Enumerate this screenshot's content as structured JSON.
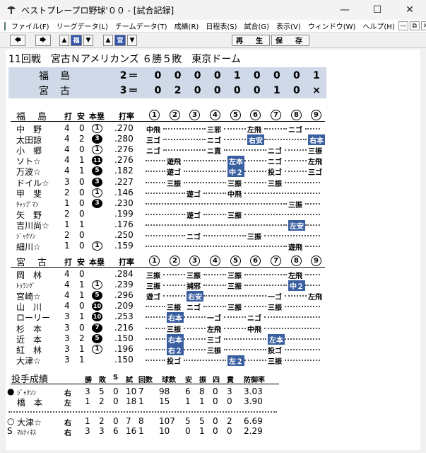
{
  "window": {
    "title": "ベストプレープロ野球'００ - [試合記録]"
  },
  "menu": [
    "ファイル(F)",
    "リーグデータ(L)",
    "チームデータ(T)",
    "成績(R)",
    "日程表(S)",
    "試合(G)",
    "表示(V)",
    "ウィンドウ(W)",
    "ヘルプ(H)"
  ],
  "toolbar": {
    "team1": "福",
    "team2": "宮",
    "replay": "再　生",
    "save": "保　存"
  },
  "game": {
    "header": "11回戦　宮古Ｎアメリカンズ ６勝５敗　東京ドーム"
  },
  "linescore": [
    {
      "team": "福島",
      "runs": "2",
      "eq": "＝",
      "innings": [
        "0",
        "0",
        "0",
        "0",
        "1",
        "0",
        "0",
        "0",
        "1"
      ]
    },
    {
      "team": "宮古",
      "runs": "3",
      "eq": "＝",
      "innings": [
        "0",
        "2",
        "0",
        "0",
        "0",
        "0",
        "1",
        "0",
        "×"
      ]
    }
  ],
  "batting_header": {
    "ab": "打",
    "h": "安",
    "hr": "本塁",
    "avg": "打率",
    "innings": [
      "1",
      "2",
      "3",
      "4",
      "5",
      "6",
      "7",
      "8",
      "9"
    ]
  },
  "fukushima": {
    "team": "福　島",
    "players": [
      {
        "name": "中　野",
        "ab": "4",
        "h": "0",
        "hr": "1",
        "avg": ".270"
      },
      {
        "name": "太田諒",
        "ab": "4",
        "h": "2",
        "hr": "3",
        "avg": ".280"
      },
      {
        "name": "小　郷",
        "ab": "4",
        "h": "0",
        "hr": "1",
        "avg": ".276"
      },
      {
        "name": "ソト☆",
        "ab": "4",
        "h": "1",
        "hr": "11",
        "avg": ".276"
      },
      {
        "name": "万波☆",
        "ab": "4",
        "h": "1",
        "hr": "5",
        "avg": ".182"
      },
      {
        "name": "ドイル☆",
        "ab": "3",
        "h": "0",
        "hr": "3",
        "avg": ".227"
      },
      {
        "name": "甲　斐",
        "ab": "2",
        "h": "0",
        "hr": "1",
        "avg": ".146"
      },
      {
        "name": "ﾁｬｯﾌﾟﾏﾝ",
        "ab": "1",
        "h": "0",
        "hr": "3",
        "avg": ".230"
      },
      {
        "name": "矢　野",
        "ab": "2",
        "h": "0",
        "hr": "",
        "avg": ".199"
      },
      {
        "name": "吉川尚☆",
        "ab": "1",
        "h": "1",
        "hr": "",
        "avg": ".176"
      },
      {
        "name": "ｼﾞｬｸｿﾝ",
        "ab": "2",
        "h": "0",
        "hr": "",
        "avg": ".250"
      },
      {
        "name": "細川☆",
        "ab": "1",
        "h": "0",
        "hr": "1",
        "avg": ".159"
      }
    ]
  },
  "miyako": {
    "team": "宮　古",
    "players": [
      {
        "name": "岡　林",
        "ab": "4",
        "h": "0",
        "hr": "",
        "avg": ".284"
      },
      {
        "name": "ﾄｩﾗﾝｸﾞ",
        "ab": "4",
        "h": "1",
        "hr": "1",
        "avg": ".239"
      },
      {
        "name": "宮崎☆",
        "ab": "4",
        "h": "1",
        "hr": "5",
        "avg": ".296"
      },
      {
        "name": "山　川",
        "ab": "4",
        "h": "0",
        "hr": "10",
        "avg": ".209"
      },
      {
        "name": "ローリー",
        "ab": "3",
        "h": "1",
        "hr": "10",
        "avg": ".253"
      },
      {
        "name": "杉　本",
        "ab": "3",
        "h": "0",
        "hr": "7",
        "avg": ".216"
      },
      {
        "name": "近　本",
        "ab": "3",
        "h": "2",
        "hr": "5",
        "avg": ".150"
      },
      {
        "name": "紅　林",
        "ab": "3",
        "h": "1",
        "hr": "1",
        "avg": ".196"
      },
      {
        "name": "大津☆",
        "ab": "3",
        "h": "1",
        "hr": "",
        "avg": ".150"
      }
    ]
  },
  "pitching": {
    "title": "投手成績",
    "headers": [
      "勝",
      "敗",
      "S",
      "試",
      "回数",
      "球数",
      "安",
      "振",
      "四",
      "責",
      "防御率"
    ],
    "rows": [
      {
        "mark": "●",
        "name": "ｼﾞｬｸｿﾝ",
        "hand": "右",
        "w": "3",
        "l": "5",
        "s": "0",
        "g": "10",
        "ip": "7",
        "np": "98",
        "h": "6",
        "so": "8",
        "bb": "0",
        "er": "3",
        "era": "3.03"
      },
      {
        "mark": "",
        "name": "橋　本",
        "hand": "左",
        "w": "1",
        "l": "2",
        "s": "0",
        "g": "18",
        "ip": "1",
        "np": "15",
        "h": "1",
        "so": "1",
        "bb": "0",
        "er": "0",
        "era": "3.90"
      },
      {
        "mark": "○",
        "name": "大津☆",
        "hand": "右",
        "w": "1",
        "l": "2",
        "s": "0",
        "g": "7",
        "ip": "8",
        "np": "107",
        "h": "5",
        "so": "5",
        "bb": "0",
        "er": "2",
        "era": "6.69"
      },
      {
        "mark": "S",
        "name": "ﾏﾙﾃｨﾈｽ",
        "hand": "右",
        "w": "3",
        "l": "3",
        "s": "6",
        "g": "16",
        "ip": "1",
        "np": "10",
        "h": "0",
        "so": "1",
        "bb": "0",
        "er": "0",
        "era": "2.29"
      }
    ]
  },
  "events_f": [
    [
      "中飛",
      "",
      "",
      "三邪",
      "",
      "左飛",
      "",
      "ニゴ",
      ""
    ],
    [
      "三ゴ",
      "",
      "",
      "ニゴ",
      "",
      "右安",
      "",
      "",
      "右本"
    ],
    [
      "ニゴ",
      "",
      "",
      "ニ直",
      "",
      "",
      "ニゴ",
      "",
      "三振"
    ],
    [
      "",
      "遊飛",
      "",
      "",
      "左本",
      "",
      "ニゴ",
      "",
      "左飛"
    ],
    [
      "",
      "遊ゴ",
      "",
      "",
      "中２",
      "",
      "投ゴ",
      "",
      "三ゴ"
    ],
    [
      "",
      "三振",
      "",
      "",
      "三振",
      "",
      "三振",
      "",
      ""
    ],
    [
      "",
      "",
      "遊ゴ",
      "",
      "中飛",
      "",
      "",
      "",
      ""
    ],
    [
      "",
      "",
      "",
      "",
      "",
      "",
      "",
      "三振",
      ""
    ],
    [
      "",
      "",
      "遊ゴ",
      "",
      "三振",
      "",
      "",
      "",
      ""
    ],
    [
      "",
      "",
      "",
      "",
      "",
      "",
      "",
      "左安",
      ""
    ],
    [
      "",
      "",
      "ニゴ",
      "",
      "",
      "三振",
      "",
      "",
      ""
    ],
    [
      "",
      "",
      "",
      "",
      "",
      "",
      "",
      "遊飛",
      ""
    ]
  ],
  "events_m": [
    [
      "三振",
      "",
      "三振",
      "",
      "三振",
      "",
      "",
      "左飛",
      ""
    ],
    [
      "三振",
      "",
      "捕邪",
      "",
      "三振",
      "",
      "",
      "中２",
      ""
    ],
    [
      "遊ゴ",
      "",
      "右安",
      "",
      "",
      "",
      "一ゴ",
      "",
      "左飛"
    ],
    [
      "",
      "三振",
      "ニゴ",
      "",
      "三振",
      "",
      "三振",
      "",
      ""
    ],
    [
      "",
      "右本",
      "",
      "一ゴ",
      "",
      "ニゴ",
      "",
      "",
      ""
    ],
    [
      "",
      "三振",
      "",
      "左飛",
      "",
      "中飛",
      "",
      "",
      ""
    ],
    [
      "",
      "右本",
      "",
      "三ゴ",
      "",
      "",
      "左本",
      "",
      ""
    ],
    [
      "",
      "右２",
      "",
      "三振",
      "",
      "",
      "投ゴ",
      "",
      ""
    ],
    [
      "",
      "投ゴ",
      "",
      "",
      "左２",
      "",
      "三振",
      "",
      ""
    ]
  ]
}
